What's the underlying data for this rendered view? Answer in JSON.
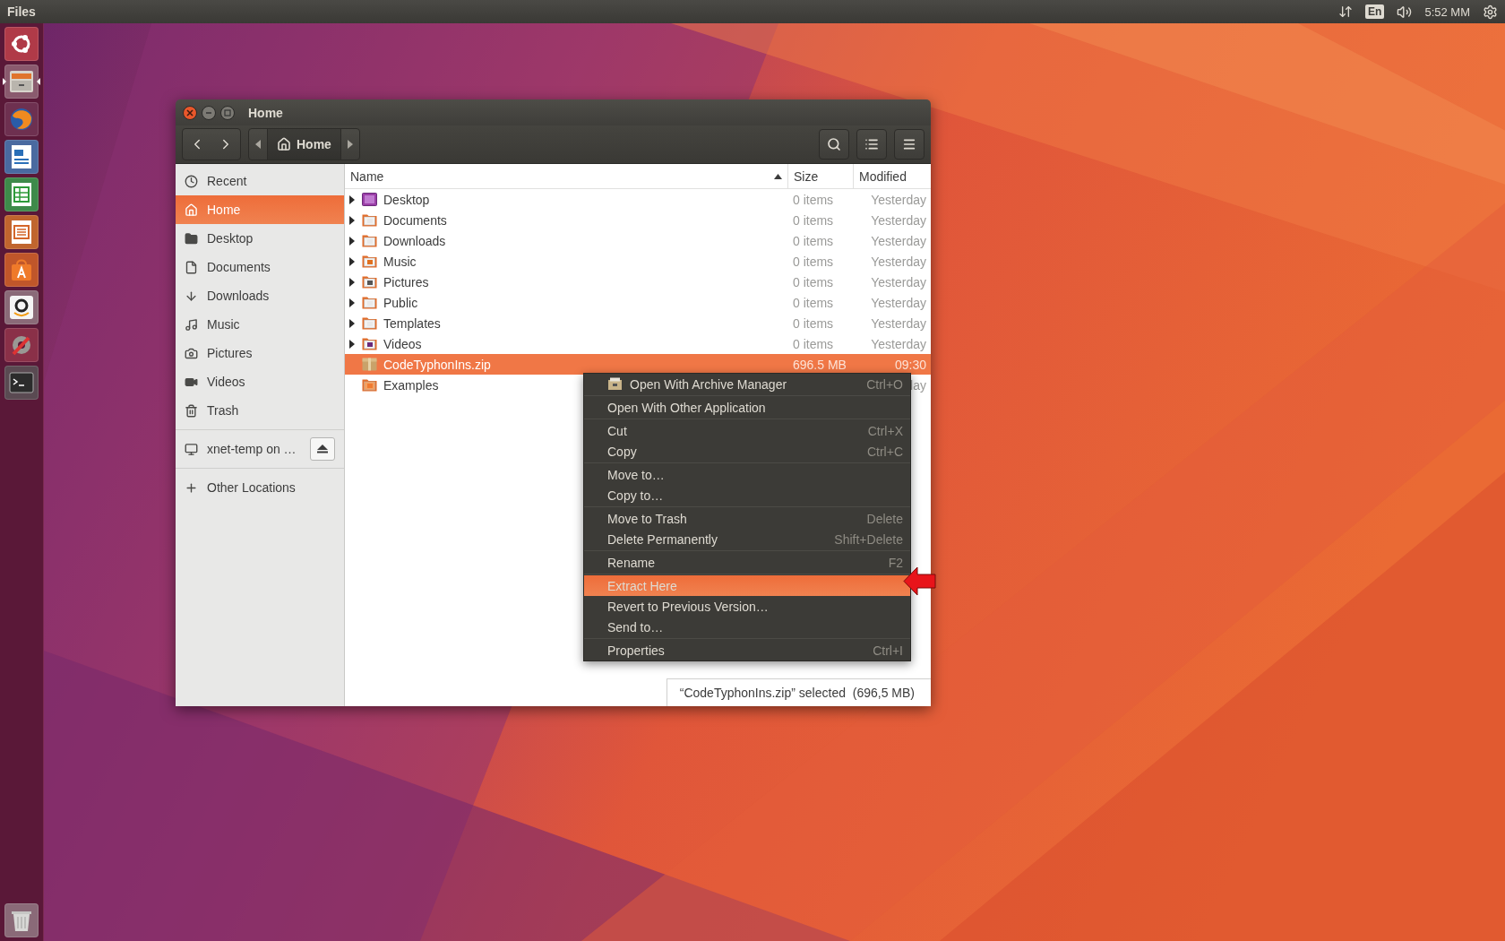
{
  "top_bar": {
    "app_name": "Files",
    "keyboard": "En",
    "clock": "5:52 MM"
  },
  "launcher": {
    "items": [
      {
        "kind": "ubuntu",
        "selected": false
      },
      {
        "kind": "files",
        "selected": true
      },
      {
        "kind": "browser",
        "selected": false
      },
      {
        "kind": "writer",
        "selected": false
      },
      {
        "kind": "calc",
        "selected": false
      },
      {
        "kind": "impress",
        "selected": false
      },
      {
        "kind": "store",
        "selected": false
      },
      {
        "kind": "amazon",
        "selected": false
      },
      {
        "kind": "settings",
        "selected": false
      },
      {
        "kind": "terminal",
        "selected": false
      }
    ],
    "trash": {
      "kind": "trash"
    }
  },
  "window": {
    "title": "Home"
  },
  "path_bar": {
    "segments": [
      {
        "label": "Home",
        "selected": true
      }
    ]
  },
  "sidebar": {
    "places": [
      {
        "label": "Recent",
        "kind": "recent",
        "selected": false
      },
      {
        "label": "Home",
        "kind": "home",
        "selected": true
      },
      {
        "label": "Desktop",
        "kind": "desktop",
        "selected": false
      },
      {
        "label": "Documents",
        "kind": "documents",
        "selected": false
      },
      {
        "label": "Downloads",
        "kind": "downloads",
        "selected": false
      },
      {
        "label": "Music",
        "kind": "music",
        "selected": false
      },
      {
        "label": "Pictures",
        "kind": "pictures",
        "selected": false
      },
      {
        "label": "Videos",
        "kind": "videos",
        "selected": false
      },
      {
        "label": "Trash",
        "kind": "trash",
        "selected": false
      }
    ],
    "mounts": [
      {
        "label": "xnet-temp on …",
        "selected": false
      }
    ],
    "other": {
      "label": "Other Locations"
    }
  },
  "table": {
    "columns": [
      {
        "label": "Name",
        "sorted": true
      },
      {
        "label": "Size",
        "sorted": false
      },
      {
        "label": "Modified",
        "sorted": false
      }
    ],
    "rows": [
      {
        "name": "Desktop",
        "kind": "desktop",
        "expandable": true,
        "size": "0 items",
        "modified": "Yesterday",
        "selected": false
      },
      {
        "name": "Documents",
        "kind": "documents",
        "expandable": true,
        "size": "0 items",
        "modified": "Yesterday",
        "selected": false
      },
      {
        "name": "Downloads",
        "kind": "downloads",
        "expandable": true,
        "size": "0 items",
        "modified": "Yesterday",
        "selected": false
      },
      {
        "name": "Music",
        "kind": "music",
        "expandable": true,
        "size": "0 items",
        "modified": "Yesterday",
        "selected": false
      },
      {
        "name": "Pictures",
        "kind": "pictures",
        "expandable": true,
        "size": "0 items",
        "modified": "Yesterday",
        "selected": false
      },
      {
        "name": "Public",
        "kind": "public",
        "expandable": true,
        "size": "0 items",
        "modified": "Yesterday",
        "selected": false
      },
      {
        "name": "Templates",
        "kind": "templates",
        "expandable": true,
        "size": "0 items",
        "modified": "Yesterday",
        "selected": false
      },
      {
        "name": "Videos",
        "kind": "videos",
        "expandable": true,
        "size": "0 items",
        "modified": "Yesterday",
        "selected": false
      },
      {
        "name": "CodeTyphonIns.zip",
        "kind": "archive",
        "expandable": false,
        "size": "696.5 MB",
        "modified": "09:30",
        "selected": true
      },
      {
        "name": "Examples",
        "kind": "folder",
        "expandable": false,
        "modified": "lay",
        "selected": false
      }
    ]
  },
  "context_menu": {
    "groups": [
      [
        {
          "label": "Open With Archive Manager",
          "shortcut": "Ctrl+O",
          "kind": "app",
          "selected": false
        }
      ],
      [
        {
          "label": "Open With Other Application",
          "selected": false
        }
      ],
      [
        {
          "label": "Cut",
          "shortcut": "Ctrl+X",
          "selected": false
        },
        {
          "label": "Copy",
          "shortcut": "Ctrl+C",
          "selected": false
        }
      ],
      [
        {
          "label": "Move to…",
          "selected": false
        },
        {
          "label": "Copy to…",
          "selected": false
        }
      ],
      [
        {
          "label": "Move to Trash",
          "shortcut": "Delete",
          "selected": false
        },
        {
          "label": "Delete Permanently",
          "shortcut": "Shift+Delete",
          "selected": false
        }
      ],
      [
        {
          "label": "Rename",
          "shortcut": "F2",
          "selected": false
        }
      ],
      [
        {
          "label": "Extract Here",
          "selected": true
        },
        {
          "label": "Revert to Previous Version…",
          "selected": false
        },
        {
          "label": "Send to…",
          "selected": false
        }
      ],
      [
        {
          "label": "Properties",
          "shortcut": "Ctrl+I",
          "selected": false
        }
      ]
    ]
  },
  "status": {
    "text": "“CodeTyphonIns.zip” selected  (696,5 MB)"
  },
  "annotation": {
    "kind": "arrow"
  }
}
